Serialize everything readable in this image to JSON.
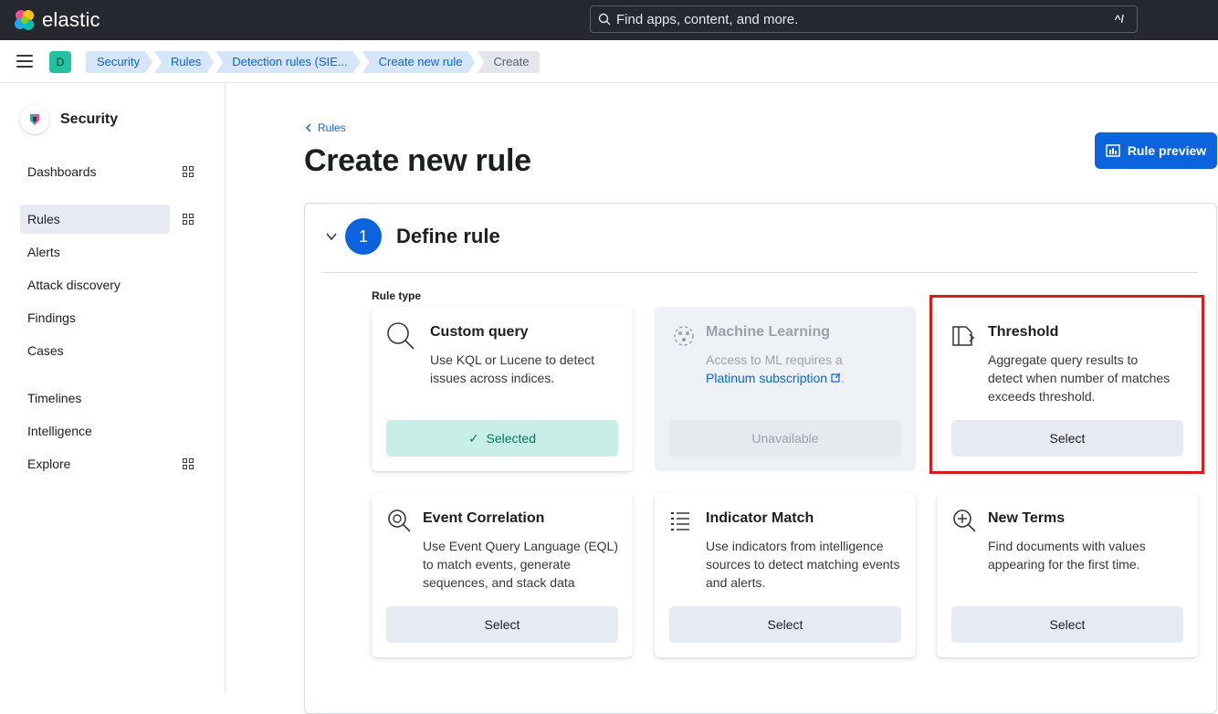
{
  "topbar": {
    "logo_text": "elastic",
    "search_placeholder": "Find apps, content, and more.",
    "search_shortcut": "^/"
  },
  "breadcrumbs": {
    "avatar": "D",
    "items": [
      "Security",
      "Rules",
      "Detection rules (SIE...",
      "Create new rule",
      "Create"
    ]
  },
  "sidebar": {
    "title": "Security",
    "items": [
      {
        "label": "Dashboards"
      },
      {
        "label": "Rules"
      },
      {
        "label": "Alerts"
      },
      {
        "label": "Attack discovery"
      },
      {
        "label": "Findings"
      },
      {
        "label": "Cases"
      },
      {
        "label": "Timelines"
      },
      {
        "label": "Intelligence"
      },
      {
        "label": "Explore"
      }
    ]
  },
  "main": {
    "back_label": "Rules",
    "title": "Create new rule",
    "preview_button": "Rule preview",
    "step": {
      "number": "1",
      "title": "Define rule"
    },
    "rule_type_label": "Rule type",
    "cards": [
      {
        "title": "Custom query",
        "desc": "Use KQL or Lucene to detect issues across indices.",
        "button": "Selected",
        "icon": "magnifier-icon"
      },
      {
        "title": "Machine Learning",
        "desc": "Access to ML requires a",
        "link": "Platinum subscription",
        "link_suffix": ".",
        "button": "Unavailable",
        "icon": "ml-icon"
      },
      {
        "title": "Threshold",
        "desc": "Aggregate query results to detect when number of matches exceeds threshold.",
        "button": "Select",
        "icon": "threshold-icon"
      },
      {
        "title": "Event Correlation",
        "desc": "Use Event Query Language (EQL) to match events, generate sequences, and stack data",
        "button": "Select",
        "icon": "eql-icon"
      },
      {
        "title": "Indicator Match",
        "desc": "Use indicators from intelligence sources to detect matching events and alerts.",
        "button": "Select",
        "icon": "list-icon"
      },
      {
        "title": "New Terms",
        "desc": "Find documents with values appearing for the first time.",
        "button": "Select",
        "icon": "zoom-plus-icon"
      }
    ]
  },
  "colors": {
    "accent": "#0b64dd",
    "topbar": "#25282f",
    "selected_bg": "#c7efe8",
    "highlight": "#d81b1b"
  }
}
